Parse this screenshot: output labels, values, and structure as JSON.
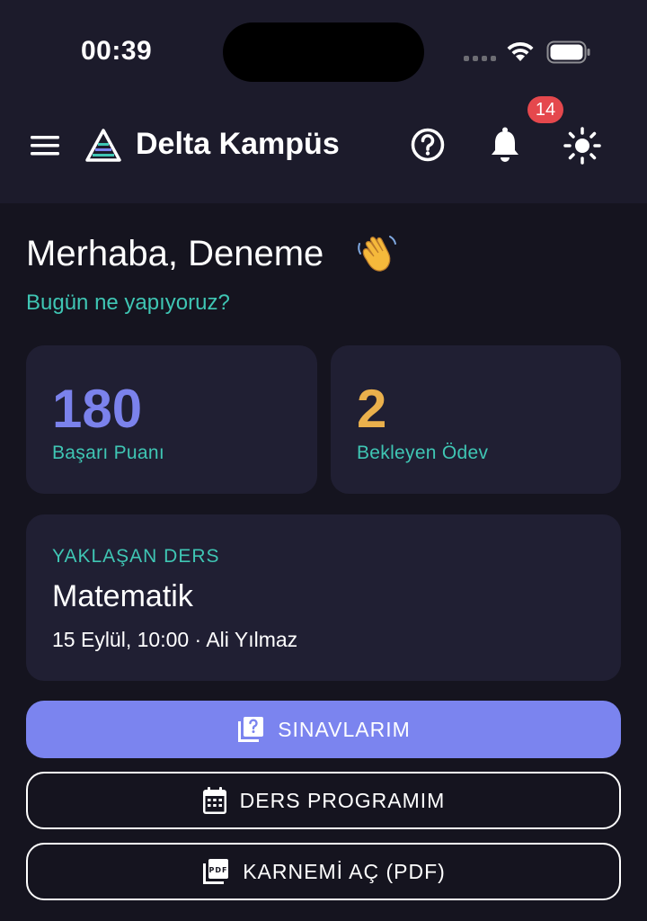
{
  "status_bar": {
    "time": "00:39"
  },
  "header": {
    "title": "Delta Kampüs",
    "notification_count": "14",
    "icons": [
      "menu-icon",
      "logo-icon",
      "help-icon",
      "bell-icon",
      "sun-icon"
    ]
  },
  "greeting": {
    "text": "Merhaba, Deneme",
    "emoji": "waving-hand-icon",
    "subtitle": "Bugün ne yapıyoruz?"
  },
  "stats": [
    {
      "value": "180",
      "label": "Başarı Puanı",
      "color": "#7b82ec"
    },
    {
      "value": "2",
      "label": "Bekleyen Ödev",
      "color": "#eab04c"
    }
  ],
  "upcoming_lesson": {
    "tag": "YAKLAŞAN DERS",
    "name": "Matematik",
    "meta": "15 Eylül, 10:00 · Ali Yılmaz"
  },
  "actions": {
    "exams_label": "SINAVLARIM",
    "schedule_label": "DERS PROGRAMIM",
    "report_label": "KARNEMİ AÇ (PDF)"
  },
  "colors": {
    "background": "#15141f",
    "header_bg": "#1c1b2b",
    "card_bg": "#201f33",
    "accent_teal": "#3fc6b4",
    "accent_purple": "#7b84ef",
    "badge_red": "#e5484d"
  }
}
